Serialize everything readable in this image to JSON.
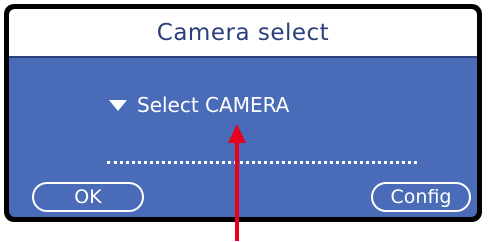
{
  "dialog": {
    "title": "Camera select",
    "select_label": "Select CAMERA",
    "ok_label": "OK",
    "config_label": "Config"
  },
  "colors": {
    "panel_blue": "#4a6cb8",
    "title_text": "#2b3f7a",
    "frame": "#000000",
    "annotation_arrow": "#e8001c"
  },
  "icons": {
    "dropdown": "triangle-down-icon"
  }
}
